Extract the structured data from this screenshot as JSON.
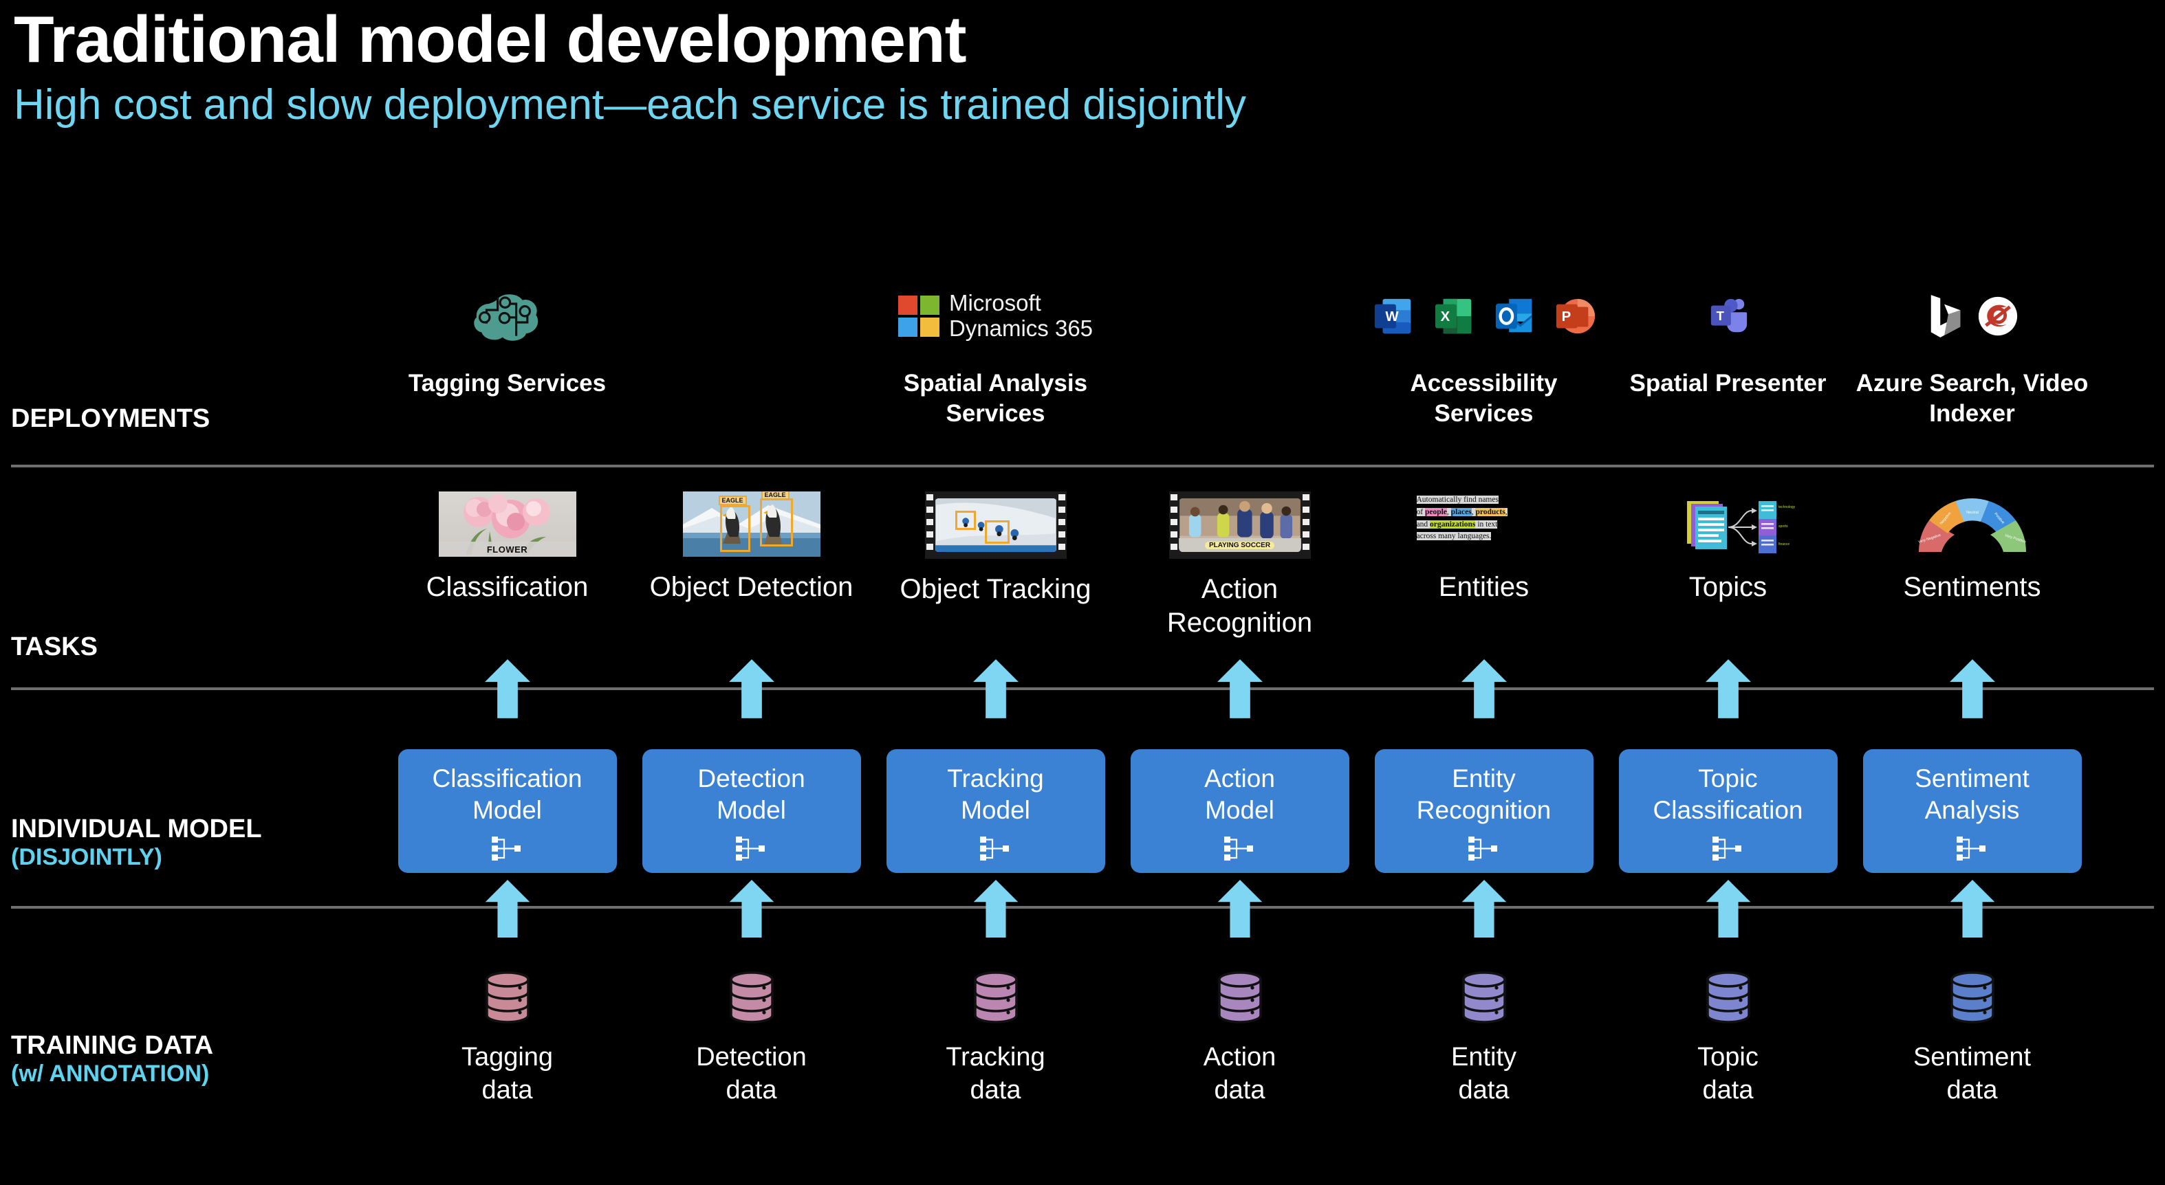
{
  "header": {
    "title": "Traditional model development",
    "subtitle": "High cost and slow deployment—each service is trained disjointly",
    "title_color": "#ffffff",
    "subtitle_color": "#6FD6F2"
  },
  "colors": {
    "background": "#000000",
    "accent_cyan": "#6FD6F2",
    "arrow": "#7ED6F2",
    "divider": "#6e6e6e",
    "model_box": "#3C82D4",
    "brain_teal": "#4E9B8F"
  },
  "rows": {
    "deployments": {
      "label_line1": "DEPLOYMENTS",
      "label_line2": ""
    },
    "tasks": {
      "label_line1": "TASKS",
      "label_line2": ""
    },
    "models": {
      "label_line1": "INDIVIDUAL MODEL",
      "label_line2": "(DISJOINTLY)"
    },
    "training": {
      "label_line1": "TRAINING DATA",
      "label_line2": "(w/ ANNOTATION)"
    }
  },
  "deployments": [
    {
      "label": "Tagging\nServices",
      "icon": "brain-icon",
      "column": 0
    },
    {
      "label": "Spatial Analysis\nServices",
      "icon": "microsoft-dynamics-365-logo",
      "logo_line1": "Microsoft",
      "logo_line2": "Dynamics 365",
      "column": 2
    },
    {
      "label": "Accessibility\nServices",
      "icon": "office-apps-icons",
      "apps": [
        "word-icon",
        "excel-icon",
        "outlook-icon",
        "powerpoint-icon"
      ],
      "column": 4
    },
    {
      "label": "Spatial\nPresenter",
      "icon": "microsoft-teams-icon",
      "column": 5
    },
    {
      "label": "Azure Search,\nVideo Indexer",
      "icon": "bing-and-video-indexer-icons",
      "column": 6
    }
  ],
  "tasks": [
    {
      "label": "Classification",
      "thumb": "flower-classification-thumbnail",
      "caption": "FLOWER"
    },
    {
      "label": "Object Detection",
      "thumb": "eagle-detection-thumbnail",
      "caption": "EAGLE"
    },
    {
      "label": "Object Tracking",
      "thumb": "cyclist-tracking-film-thumbnail",
      "caption": ""
    },
    {
      "label": "Action\nRecognition",
      "thumb": "soccer-action-film-thumbnail",
      "caption": "PLAYING SOCCER"
    },
    {
      "label": "Entities",
      "thumb": "entity-highlight-text-thumbnail",
      "caption": ""
    },
    {
      "label": "Topics",
      "thumb": "topic-documents-thumbnail",
      "caption": ""
    },
    {
      "label": "Sentiments",
      "thumb": "sentiment-gauge-thumbnail",
      "caption": ""
    }
  ],
  "entity_text": {
    "line1": "Automatically find names",
    "line2_pre": "of ",
    "people": "people",
    "sep1": ", ",
    "places": "places",
    "sep2": ", ",
    "products": "products",
    "sep3": ",",
    "line3_pre": "and ",
    "organizations": "organizations",
    "line3_post": " in text",
    "line4": "across many languages.",
    "highlight_people": "#F08BC0",
    "highlight_places": "#5BA9E0",
    "highlight_products": "#F5C05A",
    "highlight_organizations": "#C3D93B"
  },
  "sentiment_gauge": {
    "segments": [
      {
        "label": "Very Negative",
        "color": "#D96A6A"
      },
      {
        "label": "Negative",
        "color": "#EFA councillor"
      },
      {
        "label": "Neutral",
        "color": "#86C5F0"
      },
      {
        "label": "Positive",
        "color": "#3E8EE0"
      },
      {
        "label": "Very Positive",
        "color": "#8CC77A"
      }
    ]
  },
  "models": [
    {
      "label": "Classification\nModel"
    },
    {
      "label": "Detection\nModel"
    },
    {
      "label": "Tracking\nModel"
    },
    {
      "label": "Action\nModel"
    },
    {
      "label": "Entity\nRecognition"
    },
    {
      "label": "Topic\nClassification"
    },
    {
      "label": "Sentiment\nAnalysis"
    }
  ],
  "training_data": [
    {
      "label": "Tagging\ndata",
      "color": "#C98A98"
    },
    {
      "label": "Detection\ndata",
      "color": "#C48BA6"
    },
    {
      "label": "Tracking\ndata",
      "color": "#BC86B2"
    },
    {
      "label": "Action\ndata",
      "color": "#A886BE"
    },
    {
      "label": "Entity\ndata",
      "color": "#9289CC"
    },
    {
      "label": "Topic\ndata",
      "color": "#7D86CE"
    },
    {
      "label": "Sentiment\ndata",
      "color": "#5C7FCB"
    }
  ]
}
